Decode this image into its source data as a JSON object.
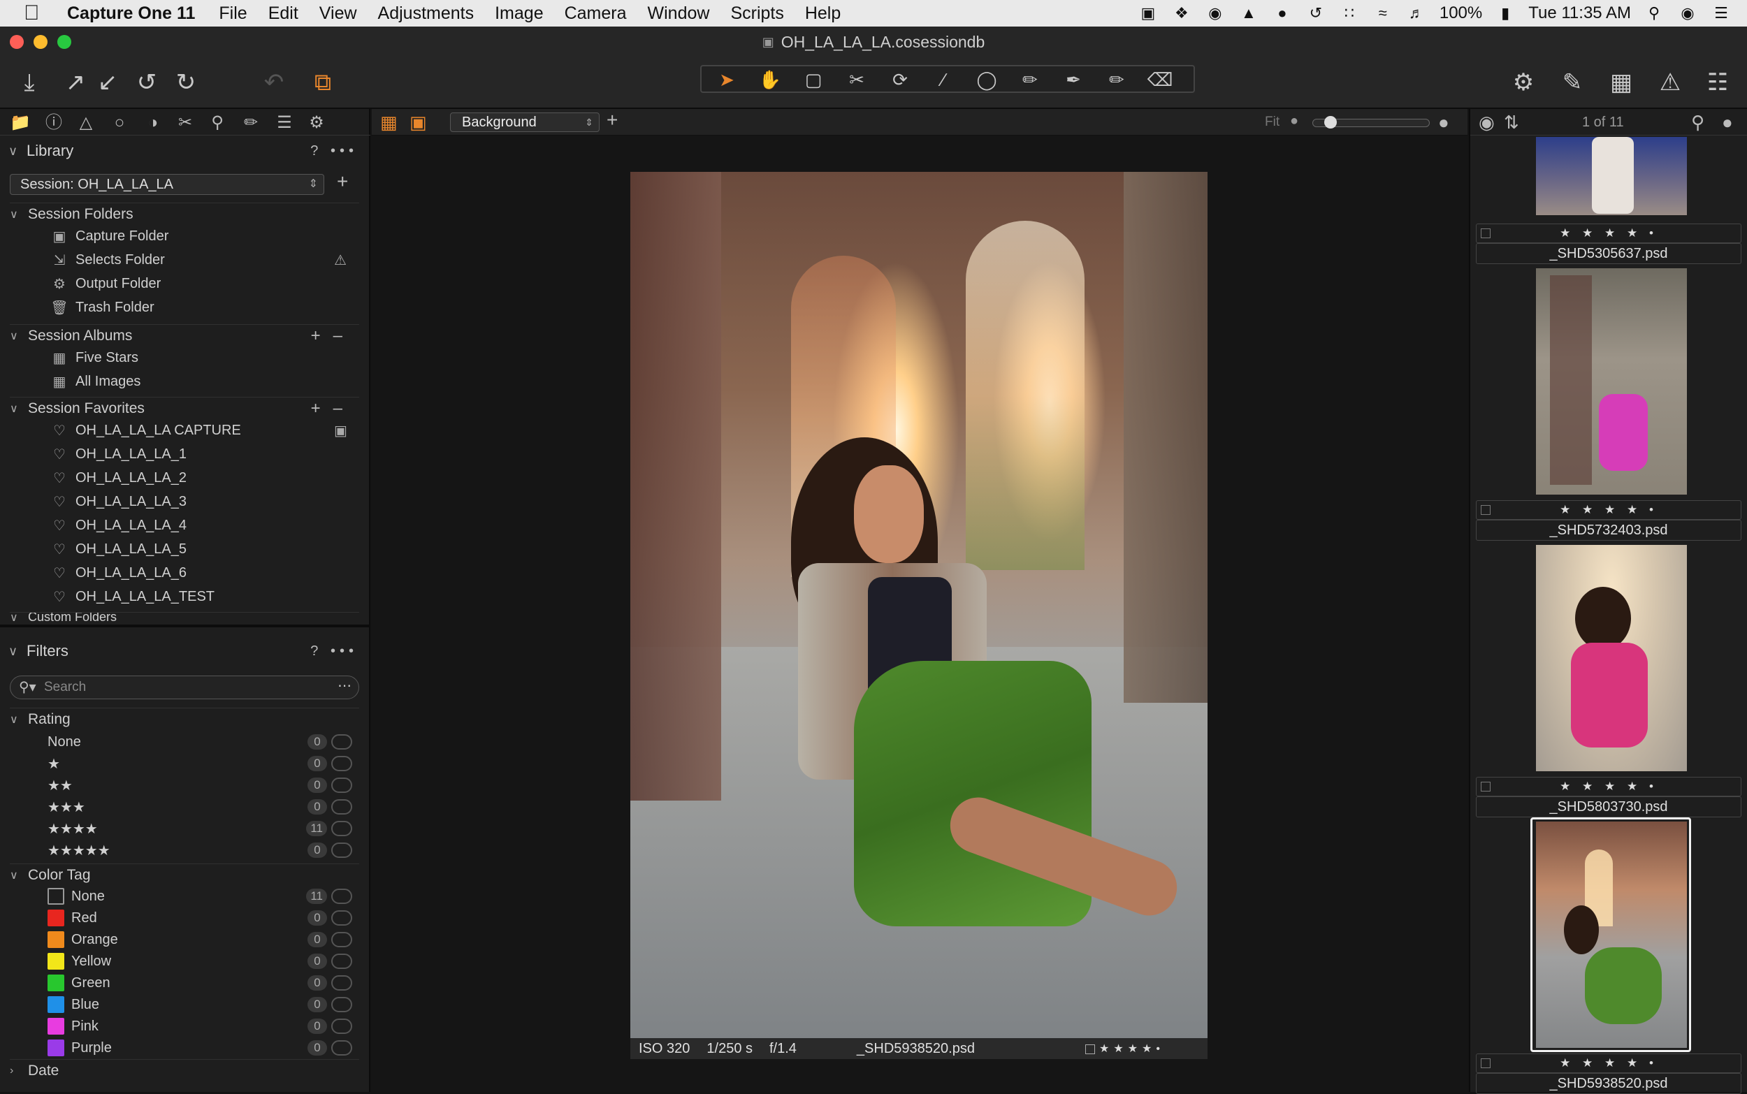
{
  "menubar": {
    "app_name": "Capture One 11",
    "items": [
      "File",
      "Edit",
      "View",
      "Adjustments",
      "Image",
      "Camera",
      "Window",
      "Scripts",
      "Help"
    ],
    "battery": "100%",
    "clock": "Tue 11:35 AM"
  },
  "window": {
    "title": "OH_LA_LA_LA.cosessiondb"
  },
  "library": {
    "title": "Library",
    "help": "?",
    "more": "•••",
    "session_select": "Session: OH_LA_LA_LA",
    "session_folders": {
      "label": "Session Folders",
      "items": [
        "Capture Folder",
        "Selects Folder",
        "Output Folder",
        "Trash Folder"
      ]
    },
    "session_albums": {
      "label": "Session Albums",
      "items": [
        "Five Stars",
        "All Images"
      ]
    },
    "session_favorites": {
      "label": "Session Favorites",
      "items": [
        "OH_LA_LA_LA CAPTURE",
        "OH_LA_LA_LA_1",
        "OH_LA_LA_LA_2",
        "OH_LA_LA_LA_3",
        "OH_LA_LA_LA_4",
        "OH_LA_LA_LA_5",
        "OH_LA_LA_LA_6",
        "OH_LA_LA_LA_TEST"
      ]
    },
    "custom_folders_label": "Custom Folders"
  },
  "filters": {
    "title": "Filters",
    "help": "?",
    "more": "•••",
    "search_placeholder": "Search",
    "rating": {
      "label": "Rating",
      "items": [
        {
          "label": "None",
          "count": "0"
        },
        {
          "label": "★",
          "count": "0"
        },
        {
          "label": "★★",
          "count": "0"
        },
        {
          "label": "★★★",
          "count": "0"
        },
        {
          "label": "★★★★",
          "count": "11"
        },
        {
          "label": "★★★★★",
          "count": "0"
        }
      ]
    },
    "color_tag": {
      "label": "Color Tag",
      "items": [
        {
          "label": "None",
          "count": "11",
          "color": "none"
        },
        {
          "label": "Red",
          "count": "0",
          "color": "#e8261f"
        },
        {
          "label": "Orange",
          "count": "0",
          "color": "#f08a1c"
        },
        {
          "label": "Yellow",
          "count": "0",
          "color": "#f2e619"
        },
        {
          "label": "Green",
          "count": "0",
          "color": "#28c72e"
        },
        {
          "label": "Blue",
          "count": "0",
          "color": "#1f90e8"
        },
        {
          "label": "Pink",
          "count": "0",
          "color": "#e83ce0"
        },
        {
          "label": "Purple",
          "count": "0",
          "color": "#9a3be8"
        }
      ]
    },
    "date_label": "Date"
  },
  "viewer": {
    "layer_select": "Background",
    "fit_label": "Fit",
    "info": {
      "iso": "ISO 320",
      "shutter": "1/250 s",
      "aperture": "f/1.4",
      "filename": "_SHD5938520.psd",
      "stars": "★★★★•"
    }
  },
  "browser": {
    "counter": "1 of 11",
    "thumbs": [
      {
        "stars": "★ ★ ★ ★ •",
        "name": "_SHD5305637.psd"
      },
      {
        "stars": "★ ★ ★ ★ •",
        "name": "_SHD5732403.psd"
      },
      {
        "stars": "★ ★ ★ ★ •",
        "name": "_SHD5803730.psd"
      },
      {
        "stars": "★ ★ ★ ★ •",
        "name": "_SHD5938520.psd"
      }
    ]
  },
  "colors": {
    "accent": "#e8862c"
  }
}
